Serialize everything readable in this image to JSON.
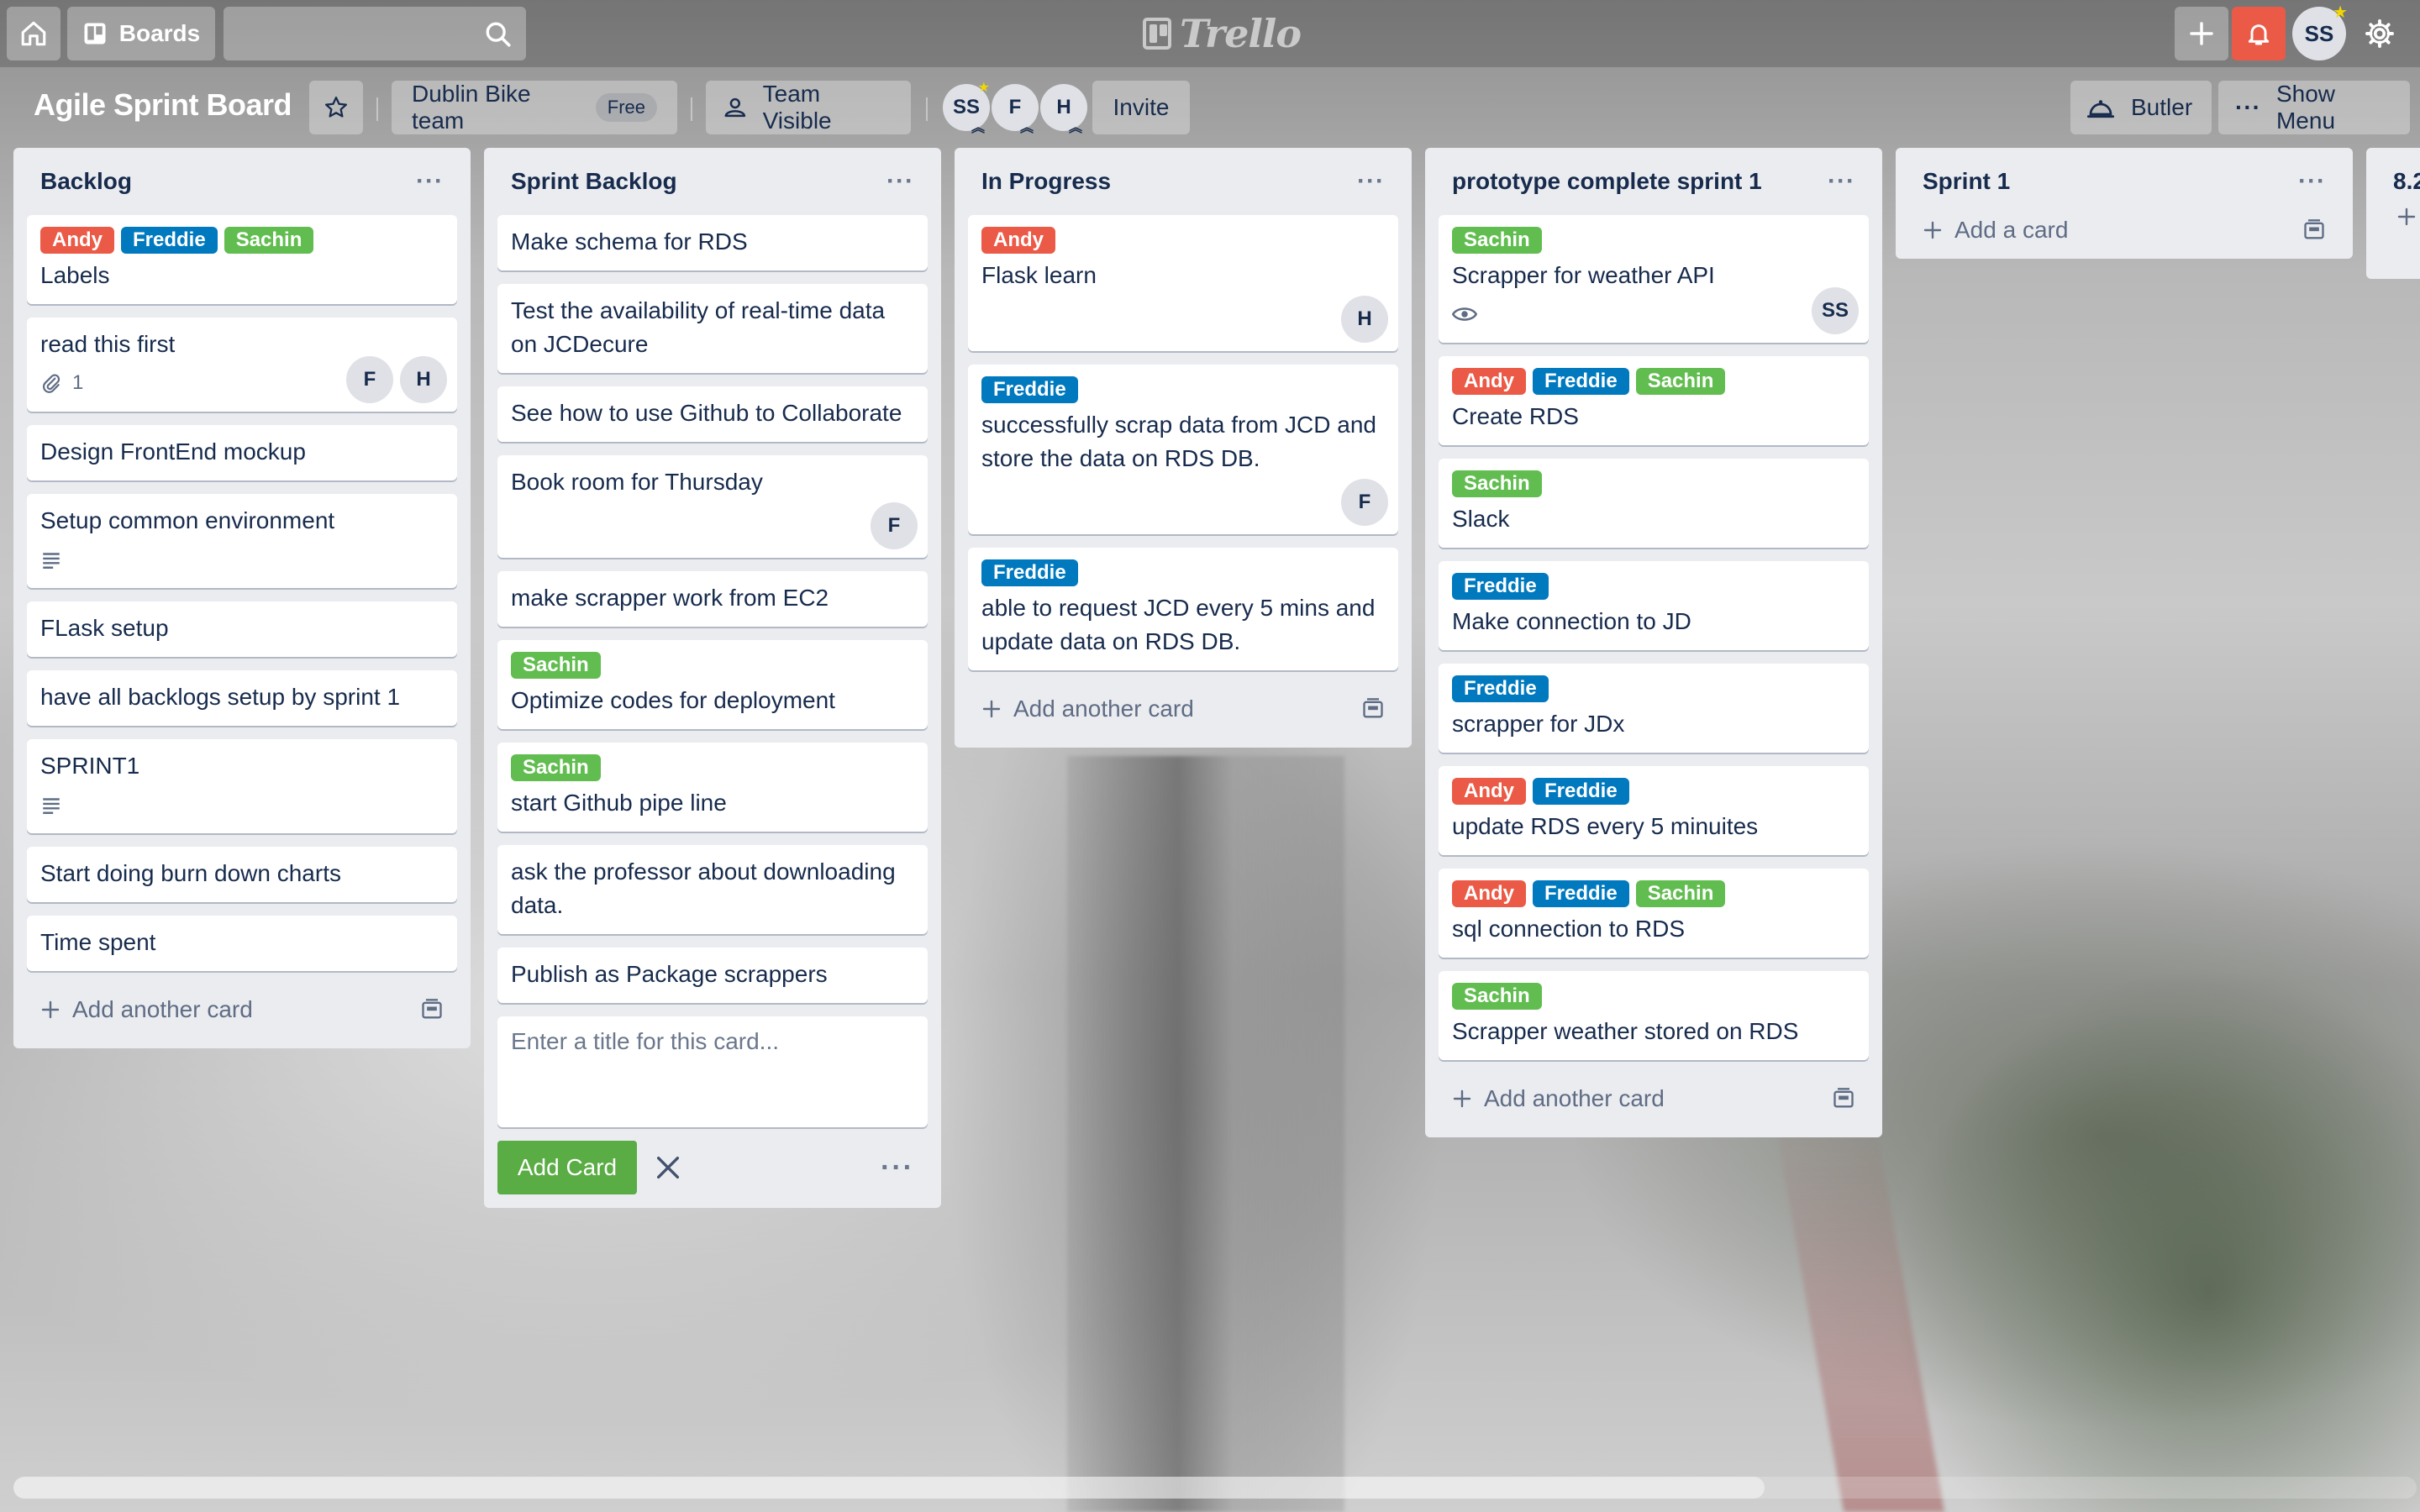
{
  "app": {
    "logo_text": "Trello"
  },
  "header": {
    "boards_label": "Boards",
    "search_value": "",
    "user_initials": "SS"
  },
  "board": {
    "title": "Agile Sprint Board",
    "team_name": "Dublin Bike team",
    "team_plan": "Free",
    "visibility": "Team Visible",
    "members": [
      "SS",
      "F",
      "H"
    ],
    "invite_label": "Invite",
    "butler_label": "Butler",
    "menu_label": "Show Menu"
  },
  "lists": [
    {
      "title": "Backlog",
      "add_label": "Add another card",
      "cards": [
        {
          "labels": [
            "Andy",
            "Freddie",
            "Sachin"
          ],
          "title": "Labels"
        },
        {
          "title": "read this first",
          "attachments": "1",
          "members": [
            "F",
            "H"
          ]
        },
        {
          "title": "Design FrontEnd mockup"
        },
        {
          "title": "Setup common environment"
        },
        {
          "title": "FLask setup"
        },
        {
          "title": "have all backlogs setup by sprint 1"
        },
        {
          "title": "SPRINT1"
        },
        {
          "title": "Start doing burn down charts"
        },
        {
          "title": "Time spent"
        }
      ]
    },
    {
      "title": "Sprint Backlog",
      "cards": [
        {
          "title": "Make schema for RDS"
        },
        {
          "title": "Test the availability of real-time data on JCDecure"
        },
        {
          "title": "See how to use Github to Collaborate"
        },
        {
          "title": "Book room for Thursday",
          "members": [
            "F"
          ]
        },
        {
          "title": "make scrapper work from EC2"
        },
        {
          "labels": [
            "Sachin"
          ],
          "title": "Optimize codes for deployment"
        },
        {
          "labels": [
            "Sachin"
          ],
          "title": "start Github pipe line"
        },
        {
          "title": "ask the professor about downloading data."
        },
        {
          "title": "Publish as Package scrappers"
        }
      ],
      "composer_placeholder": "Enter a title for this card...",
      "composer_value": "",
      "add_button_label": "Add Card"
    },
    {
      "title": "In Progress",
      "add_label": "Add another card",
      "cards": [
        {
          "labels": [
            "Andy"
          ],
          "title": "Flask learn",
          "members": [
            "H"
          ]
        },
        {
          "labels": [
            "Freddie"
          ],
          "title": "successfully scrap data from JCD and store the data on RDS DB.",
          "members": [
            "F"
          ]
        },
        {
          "labels": [
            "Freddie"
          ],
          "title": "able to request JCD every 5 mins and update data on RDS DB."
        }
      ]
    },
    {
      "title": "prototype complete sprint 1",
      "add_label": "Add another card",
      "cards": [
        {
          "labels": [
            "Sachin"
          ],
          "title": "Scrapper for weather API",
          "members": [
            "SS"
          ]
        },
        {
          "labels": [
            "Andy",
            "Freddie",
            "Sachin"
          ],
          "title": "Create RDS"
        },
        {
          "labels": [
            "Sachin"
          ],
          "title": "Slack"
        },
        {
          "labels": [
            "Freddie"
          ],
          "title": "Make connection to JD"
        },
        {
          "labels": [
            "Freddie"
          ],
          "title": "scrapper for JDx"
        },
        {
          "labels": [
            "Andy",
            "Freddie"
          ],
          "title": "update RDS every 5 minuites"
        },
        {
          "labels": [
            "Andy",
            "Freddie",
            "Sachin"
          ],
          "title": "sql connection to RDS"
        },
        {
          "labels": [
            "Sachin"
          ],
          "title": "Scrapper weather stored on RDS"
        }
      ]
    },
    {
      "title": "Sprint 1",
      "add_label": "Add a card"
    },
    {
      "title": "8.2"
    }
  ],
  "colors": {
    "andy": "#eb5a46",
    "freddie": "#0079bf",
    "sachin": "#61bd4f",
    "list_bg": "#ebecf0",
    "add_button": "#5aac44",
    "notification": "#eb5a46"
  },
  "icons": [
    "home-icon",
    "boards-icon",
    "search-icon",
    "plus-icon",
    "bell-icon",
    "gear-icon",
    "star-icon",
    "team-icon",
    "lock-icon",
    "butler-icon",
    "ellipsis-icon",
    "attachment-icon",
    "description-icon",
    "watch-icon",
    "template-icon",
    "close-icon"
  ]
}
